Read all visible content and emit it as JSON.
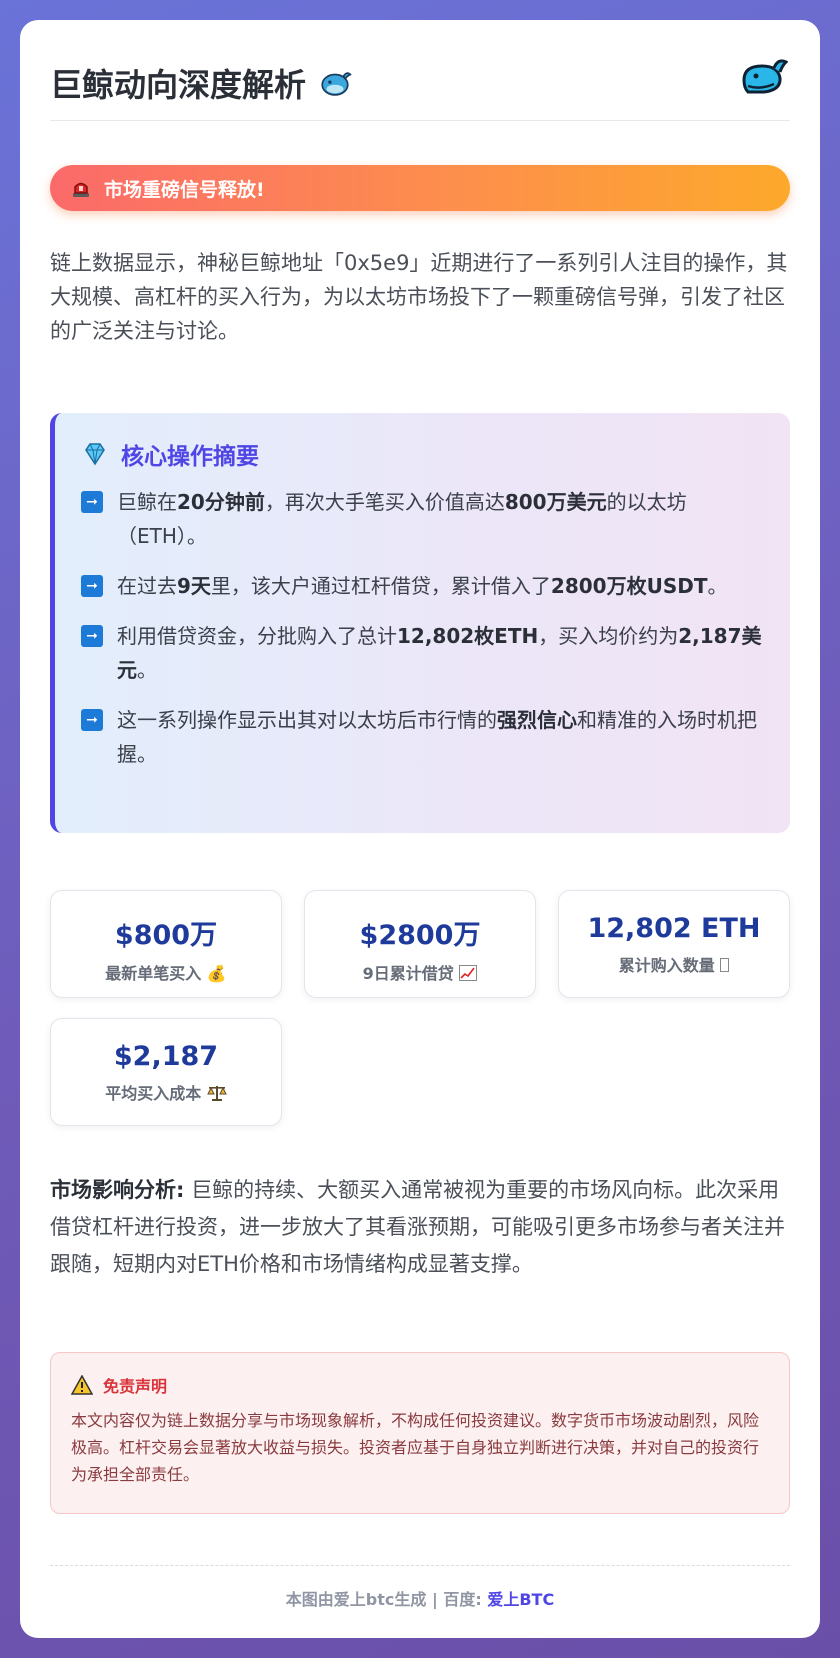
{
  "header": {
    "title": "巨鲸动向深度解析",
    "title_icon": "whale-icon"
  },
  "alert": {
    "icon": "siren-icon",
    "text": "市场重磅信号释放!"
  },
  "intro": "链上数据显示，神秘巨鲸地址「0x5e9」近期进行了一系列引人注目的操作，其大规模、高杠杆的买入行为，为以太坊市场投下了一颗重磅信号弹，引发了社区的广泛关注与讨论。",
  "summary": {
    "icon": "gem-icon",
    "title": "核心操作摘要",
    "bullets": [
      {
        "pre": "巨鲸在",
        "b1": "20分钟前",
        "mid": "，再次大手笔买入价值高达",
        "b2": "800万美元",
        "post": "的以太坊（ETH）。"
      },
      {
        "pre": "在过去",
        "b1": "9天",
        "mid": "里，该大户通过杠杆借贷，累计借入了",
        "b2": "2800万枚USDT",
        "post": "。"
      },
      {
        "pre": "利用借贷资金，分批购入了总计",
        "b1": "12,802枚ETH",
        "mid": "，买入均价约为",
        "b2": "2,187美元",
        "post": "。"
      },
      {
        "pre": "这一系列操作显示出其对以太坊后市行情的",
        "b1": "强烈信心",
        "mid": "和精准的入场时机把握。",
        "b2": "",
        "post": ""
      }
    ]
  },
  "stats": [
    {
      "value": "$800万",
      "label": "最新单笔买入",
      "icon": "money-bag-icon"
    },
    {
      "value": "$2800万",
      "label": "9日累计借贷",
      "icon": "chart-up-icon"
    },
    {
      "value": "12,802 ETH",
      "label": "累计购入数量",
      "icon": "missing-glyph-icon"
    },
    {
      "value": "$2,187",
      "label": "平均买入成本",
      "icon": "scale-icon"
    }
  ],
  "impact": {
    "label": "市场影响分析:",
    "text": "巨鲸的持续、大额买入通常被视为重要的市场风向标。此次采用借贷杠杆进行投资，进一步放大了其看涨预期，可能吸引更多市场参与者关注并跟随，短期内对ETH价格和市场情绪构成显著支撑。"
  },
  "disclaimer": {
    "icon": "warning-icon",
    "title": "免责声明",
    "text": "本文内容仅为链上数据分享与市场现象解析，不构成任何投资建议。数字货币市场波动剧烈，风险极高。杠杆交易会显著放大收益与损失。投资者应基于自身独立判断进行决策，并对自己的投资行为承担全部责任。"
  },
  "footer": {
    "text": "本图由爱上btc生成 | 百度:",
    "link": "爱上BTC"
  },
  "colors": {
    "accent": "#4f46e5",
    "stat_value": "#1e3a9a",
    "alert_start": "#fb6a6a",
    "alert_end": "#fda92b"
  }
}
